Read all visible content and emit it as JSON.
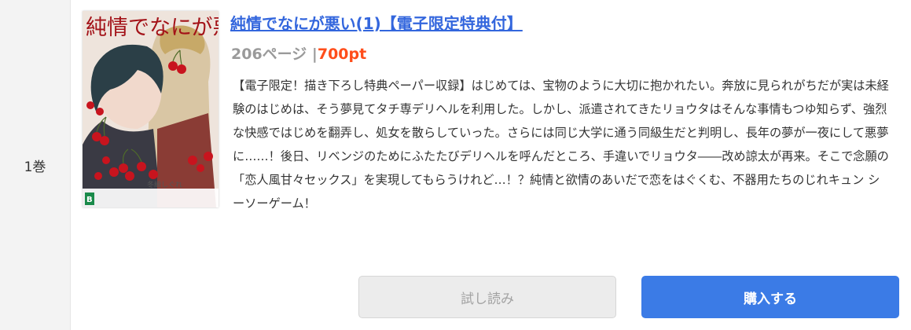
{
  "volume": {
    "label": "1巻"
  },
  "book": {
    "title": "純情でなにが悪い(1)【電子限定特典付】",
    "pages": "206ページ",
    "separator": "|",
    "price": "700pt",
    "description": "【電子限定！描き下ろし特典ペーパー収録】はじめては、宝物のように大切に抱かれたい。奔放に見られがちだが実は未経験のはじめは、そう夢見てタチ専デリヘルを利用した。しかし、派遣されてきたリョウタはそんな事情もつゆ知らず、強烈な快感ではじめを翻弄し、処女を散らしていった。さらには同じ大学に通う同級生だと判明し、長年の夢が一夜にして悪夢に……！後日、リベンジのためにふたたびデリヘルを呼んだところ、手違いでリョウタ――改め諒太が再来。そこで念願の「恋人風甘々セックス」を実現してもらうけれど…！？純情と欲情のあいだで恋をはぐくむ、不器用たちのじれキュン シーソーゲーム！",
    "cover": {
      "title_text": "純情でなにが悪い",
      "author_text": "冬織しぐれ",
      "publisher_mark": "B"
    }
  },
  "actions": {
    "trial_label": "試し読み",
    "buy_label": "購入する"
  }
}
